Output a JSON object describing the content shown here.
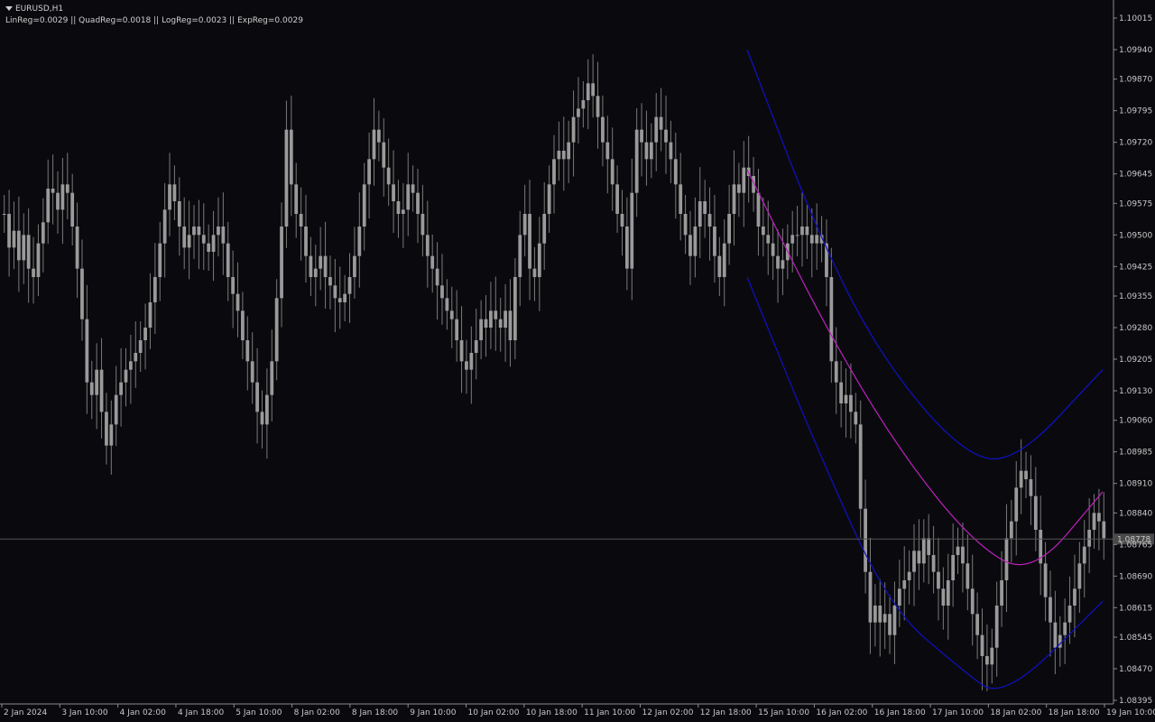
{
  "header": {
    "symbol": "EURUSD,H1",
    "indicators_line": "LinReg=0.0029 || QuadReg=0.0018 || LogReg=0.0023 || ExpReg=0.0029"
  },
  "colors": {
    "background": "#0a0a0e",
    "candle": "#9a9a9a",
    "wick": "#7a7a7a",
    "axis": "#8a8a8a",
    "regression_mid": "#c020c0",
    "regression_band": "#1010c8",
    "price_line": "#555555",
    "price_tag_bg": "#4a4a4a"
  },
  "chart_data": {
    "type": "line",
    "symbol": "EURUSD",
    "timeframe": "H1",
    "y_axis_ticks": [
      "1.10015",
      "1.09940",
      "1.09870",
      "1.09795",
      "1.09720",
      "1.09645",
      "1.09575",
      "1.09500",
      "1.09425",
      "1.09355",
      "1.09280",
      "1.09205",
      "1.09130",
      "1.09060",
      "1.08985",
      "1.08910",
      "1.08840",
      "1.08765",
      "1.08690",
      "1.08615",
      "1.08545",
      "1.08470",
      "1.08395"
    ],
    "ylim": [
      1.08395,
      1.10015
    ],
    "x_axis_ticks": [
      "2 Jan 2024",
      "3 Jan 10:00",
      "4 Jan 02:00",
      "4 Jan 18:00",
      "5 Jan 10:00",
      "8 Jan 02:00",
      "8 Jan 18:00",
      "9 Jan 10:00",
      "10 Jan 02:00",
      "10 Jan 18:00",
      "11 Jan 10:00",
      "12 Jan 02:00",
      "12 Jan 18:00",
      "15 Jan 10:00",
      "16 Jan 02:00",
      "16 Jan 18:00",
      "17 Jan 10:00",
      "18 Jan 02:00",
      "18 Jan 18:00",
      "19 Jan 10:00"
    ],
    "current_price": "1.08778",
    "close_series": [
      1.0955,
      1.0947,
      1.0951,
      1.0944,
      1.095,
      1.0942,
      1.094,
      1.0948,
      1.0953,
      1.0961,
      1.096,
      1.0956,
      1.0962,
      1.096,
      1.0952,
      1.0942,
      1.093,
      1.0915,
      1.0912,
      1.0918,
      1.0908,
      1.09,
      1.0905,
      1.0912,
      1.0915,
      1.0918,
      1.092,
      1.0922,
      1.0925,
      1.0928,
      1.0934,
      1.094,
      1.0948,
      1.0956,
      1.0962,
      1.0958,
      1.0952,
      1.0947,
      1.095,
      1.0952,
      1.095,
      1.0948,
      1.0946,
      1.095,
      1.0952,
      1.0948,
      1.094,
      1.0936,
      1.0932,
      1.0925,
      1.092,
      1.0915,
      1.0908,
      1.0905,
      1.0912,
      1.092,
      1.0935,
      1.0952,
      1.0975,
      1.0962,
      1.0955,
      1.0952,
      1.0945,
      1.094,
      1.0942,
      1.0945,
      1.094,
      1.0938,
      1.0935,
      1.0934,
      1.0936,
      1.094,
      1.0945,
      1.0952,
      1.0962,
      1.0968,
      1.0975,
      1.0972,
      1.0966,
      1.0962,
      1.0958,
      1.0955,
      1.0956,
      1.0962,
      1.096,
      1.0955,
      1.095,
      1.0945,
      1.0942,
      1.0938,
      1.0935,
      1.0932,
      1.093,
      1.0925,
      1.092,
      1.0918,
      1.0922,
      1.0925,
      1.093,
      1.0928,
      1.0932,
      1.093,
      1.0928,
      1.0932,
      1.0925,
      1.094,
      1.095,
      1.0955,
      1.0942,
      1.094,
      1.0948,
      1.0955,
      1.0962,
      1.0968,
      1.097,
      1.0968,
      1.0972,
      1.0978,
      1.098,
      1.0982,
      1.0986,
      1.0983,
      1.0978,
      1.0972,
      1.0968,
      1.0962,
      1.0955,
      1.0952,
      1.0942,
      1.096,
      1.0975,
      1.0972,
      1.0968,
      1.0972,
      1.0978,
      1.0975,
      1.0972,
      1.0968,
      1.0962,
      1.0955,
      1.095,
      1.0945,
      1.0952,
      1.0958,
      1.0955,
      1.0952,
      1.0945,
      1.094,
      1.0948,
      1.0955,
      1.0962,
      1.096,
      1.0966,
      1.0964,
      1.096,
      1.0952,
      1.095,
      1.0948,
      1.0945,
      1.0942,
      1.0944,
      1.0948,
      1.095,
      1.095,
      1.0952,
      1.095,
      1.0948,
      1.095,
      1.0948,
      1.094,
      1.092,
      1.0915,
      1.091,
      1.0912,
      1.0908,
      1.0905,
      1.0885,
      1.087,
      1.0858,
      1.0862,
      1.0858,
      1.086,
      1.0855,
      1.0862,
      1.0866,
      1.0868,
      1.087,
      1.0875,
      1.0872,
      1.0878,
      1.0874,
      1.087,
      1.0866,
      1.0862,
      1.0868,
      1.0874,
      1.0876,
      1.0872,
      1.0866,
      1.086,
      1.0855,
      1.085,
      1.0848,
      1.0852,
      1.0862,
      1.0868,
      1.0878,
      1.0882,
      1.089,
      1.0894,
      1.0892,
      1.0888,
      1.088,
      1.0872,
      1.0864,
      1.0858,
      1.0852,
      1.0855,
      1.0858,
      1.0862,
      1.0866,
      1.0872,
      1.0876,
      1.088,
      1.0884,
      1.0882,
      1.0878
    ],
    "regression": {
      "mid": [
        [
          1.09655,
          0
        ],
        [
          1.0928,
          0.22
        ],
        [
          1.08985,
          0.43
        ],
        [
          1.08765,
          0.64
        ],
        [
          1.0869,
          0.8
        ],
        [
          1.0889,
          1.0
        ]
      ],
      "upper": [
        [
          1.0994,
          0
        ],
        [
          1.095,
          0.2
        ],
        [
          1.09205,
          0.38
        ],
        [
          1.08985,
          0.6
        ],
        [
          1.08955,
          0.75
        ],
        [
          1.0918,
          1.0
        ]
      ],
      "lower": [
        [
          1.094,
          0
        ],
        [
          1.08985,
          0.2
        ],
        [
          1.08615,
          0.4
        ],
        [
          1.0847,
          0.6
        ],
        [
          1.08395,
          0.72
        ],
        [
          1.0863,
          1.0
        ]
      ]
    }
  }
}
